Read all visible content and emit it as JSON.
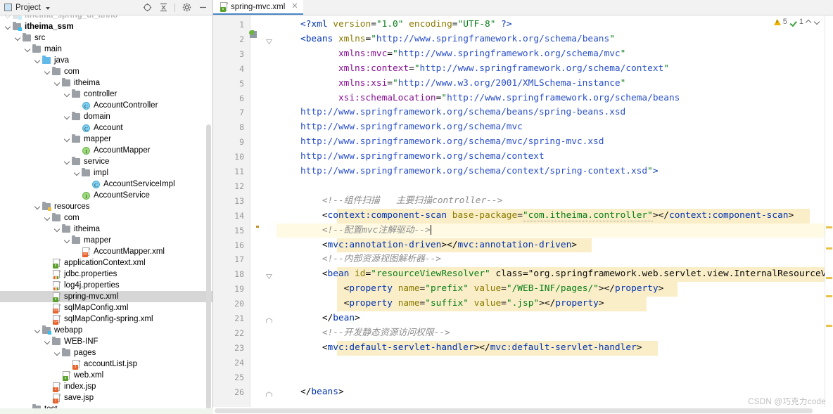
{
  "window": {
    "watermark": "CSDN @巧克力code"
  },
  "project_panel": {
    "title": "Project",
    "title_caret_icon": "chevron-down-icon",
    "toolbar": [
      {
        "name": "locate-in-tree-icon",
        "glyph": "⊕"
      },
      {
        "name": "collapse-all-icon",
        "glyph": "⇥"
      },
      {
        "name": "settings-gear-icon",
        "glyph": "⚙"
      },
      {
        "name": "hide-panel-icon",
        "glyph": "—"
      }
    ],
    "tree": [
      {
        "label": "itheima_spring_di_anno",
        "depth": 1,
        "icon": "module-folder-icon",
        "arrow": true,
        "faded": true,
        "bold": true,
        "selected": false
      },
      {
        "label": "itheima_ssm",
        "depth": 1,
        "icon": "module-folder-icon",
        "arrow": true,
        "faded": false,
        "bold": true,
        "selected": false
      },
      {
        "label": "src",
        "depth": 2,
        "icon": "folder-icon",
        "arrow": true,
        "faded": false,
        "bold": false,
        "selected": false
      },
      {
        "label": "main",
        "depth": 3,
        "icon": "folder-icon",
        "arrow": true,
        "faded": false,
        "bold": false,
        "selected": false
      },
      {
        "label": "java",
        "depth": 4,
        "icon": "source-folder-icon",
        "arrow": true,
        "faded": false,
        "bold": false,
        "selected": false
      },
      {
        "label": "com",
        "depth": 5,
        "icon": "package-folder-icon",
        "arrow": true,
        "faded": false,
        "bold": false,
        "selected": false
      },
      {
        "label": "itheima",
        "depth": 6,
        "icon": "package-folder-icon",
        "arrow": true,
        "faded": false,
        "bold": false,
        "selected": false
      },
      {
        "label": "controller",
        "depth": 7,
        "icon": "package-folder-icon",
        "arrow": true,
        "faded": false,
        "bold": false,
        "selected": false
      },
      {
        "label": "AccountController",
        "depth": 8,
        "icon": "java-class-icon",
        "arrow": false,
        "faded": false,
        "bold": false,
        "selected": false
      },
      {
        "label": "domain",
        "depth": 7,
        "icon": "package-folder-icon",
        "arrow": true,
        "faded": false,
        "bold": false,
        "selected": false
      },
      {
        "label": "Account",
        "depth": 8,
        "icon": "java-class-icon",
        "arrow": false,
        "faded": false,
        "bold": false,
        "selected": false
      },
      {
        "label": "mapper",
        "depth": 7,
        "icon": "package-folder-icon",
        "arrow": true,
        "faded": false,
        "bold": false,
        "selected": false
      },
      {
        "label": "AccountMapper",
        "depth": 8,
        "icon": "java-interface-icon",
        "arrow": false,
        "faded": false,
        "bold": false,
        "selected": false
      },
      {
        "label": "service",
        "depth": 7,
        "icon": "package-folder-icon",
        "arrow": true,
        "faded": false,
        "bold": false,
        "selected": false
      },
      {
        "label": "impl",
        "depth": 8,
        "icon": "package-folder-icon",
        "arrow": true,
        "faded": false,
        "bold": false,
        "selected": false
      },
      {
        "label": "AccountServiceImpl",
        "depth": 9,
        "icon": "java-class-icon",
        "arrow": false,
        "faded": false,
        "bold": false,
        "selected": false
      },
      {
        "label": "AccountService",
        "depth": 8,
        "icon": "java-interface-icon",
        "arrow": false,
        "faded": false,
        "bold": false,
        "selected": false
      },
      {
        "label": "resources",
        "depth": 4,
        "icon": "resources-folder-icon",
        "arrow": true,
        "faded": false,
        "bold": false,
        "selected": false
      },
      {
        "label": "com",
        "depth": 5,
        "icon": "folder-icon",
        "arrow": true,
        "faded": false,
        "bold": false,
        "selected": false
      },
      {
        "label": "itheima",
        "depth": 6,
        "icon": "folder-icon",
        "arrow": true,
        "faded": false,
        "bold": false,
        "selected": false
      },
      {
        "label": "mapper",
        "depth": 7,
        "icon": "folder-icon",
        "arrow": true,
        "faded": false,
        "bold": false,
        "selected": false
      },
      {
        "label": "AccountMapper.xml",
        "depth": 8,
        "icon": "xml-file-icon",
        "arrow": false,
        "faded": false,
        "bold": false,
        "selected": false
      },
      {
        "label": "applicationContext.xml",
        "depth": 5,
        "icon": "spring-xml-file-icon",
        "arrow": false,
        "faded": false,
        "bold": false,
        "selected": false
      },
      {
        "label": "jdbc.properties",
        "depth": 5,
        "icon": "properties-file-icon",
        "arrow": false,
        "faded": false,
        "bold": false,
        "selected": false
      },
      {
        "label": "log4j.properties",
        "depth": 5,
        "icon": "properties-file-icon",
        "arrow": false,
        "faded": false,
        "bold": false,
        "selected": false
      },
      {
        "label": "spring-mvc.xml",
        "depth": 5,
        "icon": "spring-xml-file-icon",
        "arrow": false,
        "faded": false,
        "bold": false,
        "selected": true
      },
      {
        "label": "sqlMapConfig.xml",
        "depth": 5,
        "icon": "xml-file-icon",
        "arrow": false,
        "faded": false,
        "bold": false,
        "selected": false
      },
      {
        "label": "sqlMapConfig-spring.xml",
        "depth": 5,
        "icon": "xml-file-icon",
        "arrow": false,
        "faded": false,
        "bold": false,
        "selected": false
      },
      {
        "label": "webapp",
        "depth": 4,
        "icon": "web-folder-icon",
        "arrow": true,
        "faded": false,
        "bold": false,
        "selected": false
      },
      {
        "label": "WEB-INF",
        "depth": 5,
        "icon": "folder-icon",
        "arrow": true,
        "faded": false,
        "bold": false,
        "selected": false
      },
      {
        "label": "pages",
        "depth": 6,
        "icon": "folder-icon",
        "arrow": true,
        "faded": false,
        "bold": false,
        "selected": false
      },
      {
        "label": "accountList.jsp",
        "depth": 7,
        "icon": "jsp-file-icon",
        "arrow": false,
        "faded": false,
        "bold": false,
        "selected": false
      },
      {
        "label": "web.xml",
        "depth": 6,
        "icon": "spring-xml-file-icon",
        "arrow": false,
        "faded": false,
        "bold": false,
        "selected": false
      },
      {
        "label": "index.jsp",
        "depth": 5,
        "icon": "jsp-file-icon",
        "arrow": false,
        "faded": false,
        "bold": false,
        "selected": false
      },
      {
        "label": "save.jsp",
        "depth": 5,
        "icon": "jsp-file-icon",
        "arrow": false,
        "faded": false,
        "bold": false,
        "selected": false
      },
      {
        "label": "test",
        "depth": 3,
        "icon": "folder-icon",
        "arrow": true,
        "faded": false,
        "bold": false,
        "selected": false
      }
    ]
  },
  "editor": {
    "tab": {
      "label": "spring-mvc.xml",
      "icon": "spring-xml-file-icon",
      "close_icon": "close-icon"
    },
    "inspections": {
      "warning_icon": "warning-triangle-icon",
      "warning_count": "5",
      "ok_icon": "green-check-icon",
      "ok_count": "1",
      "prev_icon": "chevron-up-icon",
      "next_icon": "chevron-down-icon"
    },
    "line_numbers": [
      "1",
      "2",
      "3",
      "4",
      "5",
      "6",
      "7",
      "8",
      "9",
      "10",
      "11",
      "12",
      "13",
      "14",
      "15",
      "16",
      "17",
      "18",
      "19",
      "20",
      "21",
      "22",
      "23",
      "24",
      "25",
      "26"
    ],
    "gutter_icons": [
      {
        "line": 2,
        "name": "spring-bean-gutter-icon"
      },
      {
        "line": 14,
        "name": "spring-bean-gutter-icon"
      },
      {
        "line": 15,
        "name": "intention-bulb-icon"
      }
    ],
    "code_lines": [
      {
        "n": 1,
        "text": "<?xml version=\"1.0\" encoding=\"UTF-8\" ?>"
      },
      {
        "n": 2,
        "text": "<beans xmlns=\"http://www.springframework.org/schema/beans\""
      },
      {
        "n": 3,
        "text": "       xmlns:mvc=\"http://www.springframework.org/schema/mvc\""
      },
      {
        "n": 4,
        "text": "       xmlns:context=\"http://www.springframework.org/schema/context\""
      },
      {
        "n": 5,
        "text": "       xmlns:xsi=\"http://www.w3.org/2001/XMLSchema-instance\""
      },
      {
        "n": 6,
        "text": "       xsi:schemaLocation=\"http://www.springframework.org/schema/beans"
      },
      {
        "n": 7,
        "text": "http://www.springframework.org/schema/beans/spring-beans.xsd"
      },
      {
        "n": 8,
        "text": "http://www.springframework.org/schema/mvc"
      },
      {
        "n": 9,
        "text": "http://www.springframework.org/schema/mvc/spring-mvc.xsd"
      },
      {
        "n": 10,
        "text": "http://www.springframework.org/schema/context"
      },
      {
        "n": 11,
        "text": "http://www.springframework.org/schema/context/spring-context.xsd\">"
      },
      {
        "n": 12,
        "text": ""
      },
      {
        "n": 13,
        "text": "    <!--组件扫描   主要扫描controller-->"
      },
      {
        "n": 14,
        "text": "    <context:component-scan base-package=\"com.itheima.controller\"></context:component-scan>"
      },
      {
        "n": 15,
        "text": "    <!--配置mvc注解驱动-->"
      },
      {
        "n": 16,
        "text": "    <mvc:annotation-driven></mvc:annotation-driven>"
      },
      {
        "n": 17,
        "text": "    <!--内部资源视图解析器-->"
      },
      {
        "n": 18,
        "text": "    <bean id=\"resourceViewResolver\" class=\"org.springframework.web.servlet.view.InternalResourceViewResolve"
      },
      {
        "n": 19,
        "text": "        <property name=\"prefix\" value=\"/WEB-INF/pages/\"></property>"
      },
      {
        "n": 20,
        "text": "        <property name=\"suffix\" value=\".jsp\"></property>"
      },
      {
        "n": 21,
        "text": "    </bean>"
      },
      {
        "n": 22,
        "text": "    <!--开发静态资源访问权限-->"
      },
      {
        "n": 23,
        "text": "    <mvc:default-servlet-handler></mvc:default-servlet-handler>"
      },
      {
        "n": 24,
        "text": ""
      },
      {
        "n": 25,
        "text": ""
      },
      {
        "n": 26,
        "text": "</beans>"
      }
    ],
    "marker_positions": [
      300,
      330,
      372,
      398,
      440
    ],
    "colors": {
      "tag": "#0033b3",
      "attribute": "#8a7b00",
      "value": "#067d17",
      "comment": "#8c8c8c",
      "url": "#2a50c8",
      "namespace": "#871094",
      "highlight": "#faeec8",
      "caret_line": "#fffae3",
      "selection": "#d6d6d6",
      "tab_underline": "#4a86c8"
    }
  }
}
